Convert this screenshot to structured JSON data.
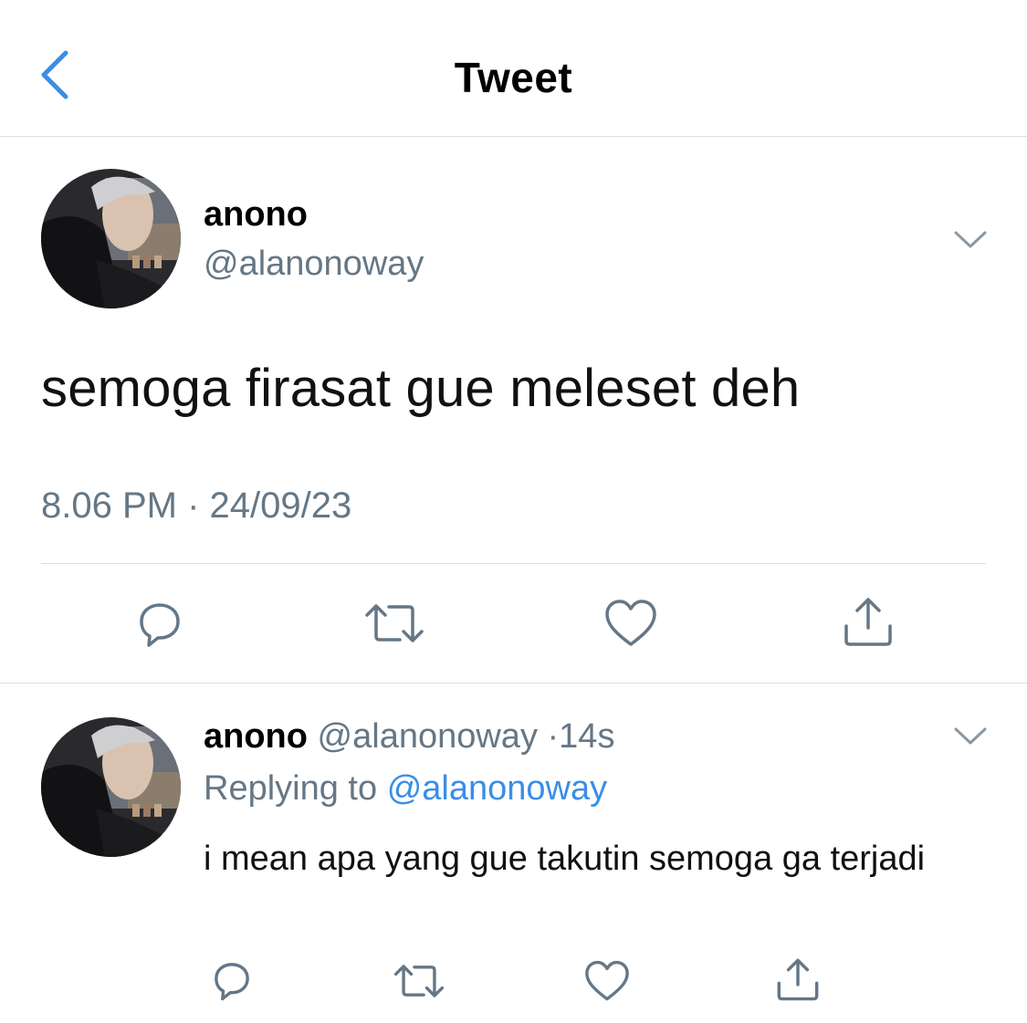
{
  "header": {
    "title": "Tweet",
    "back_icon": "chevron-left-icon",
    "accent_color": "#3a8ee6"
  },
  "tweet": {
    "display_name": "anono",
    "handle": "@alanonoway",
    "text": "semoga firasat gue meleset deh",
    "timestamp": "8.06 PM · 24/09/23",
    "actions": [
      "reply-icon",
      "retweet-icon",
      "like-icon",
      "share-icon"
    ]
  },
  "reply": {
    "display_name": "anono",
    "handle": "@alanonoway",
    "separator": "·",
    "age": "14s",
    "replying_prefix": "Replying to",
    "replying_to": "@alanonoway",
    "text": "i mean apa yang gue takutin semoga ga terjadi",
    "actions": [
      "reply-icon",
      "retweet-icon",
      "like-icon",
      "share-icon"
    ]
  },
  "colors": {
    "secondary_text": "#657786",
    "mention": "#3a8ee6",
    "divider": "#d9dde0"
  }
}
